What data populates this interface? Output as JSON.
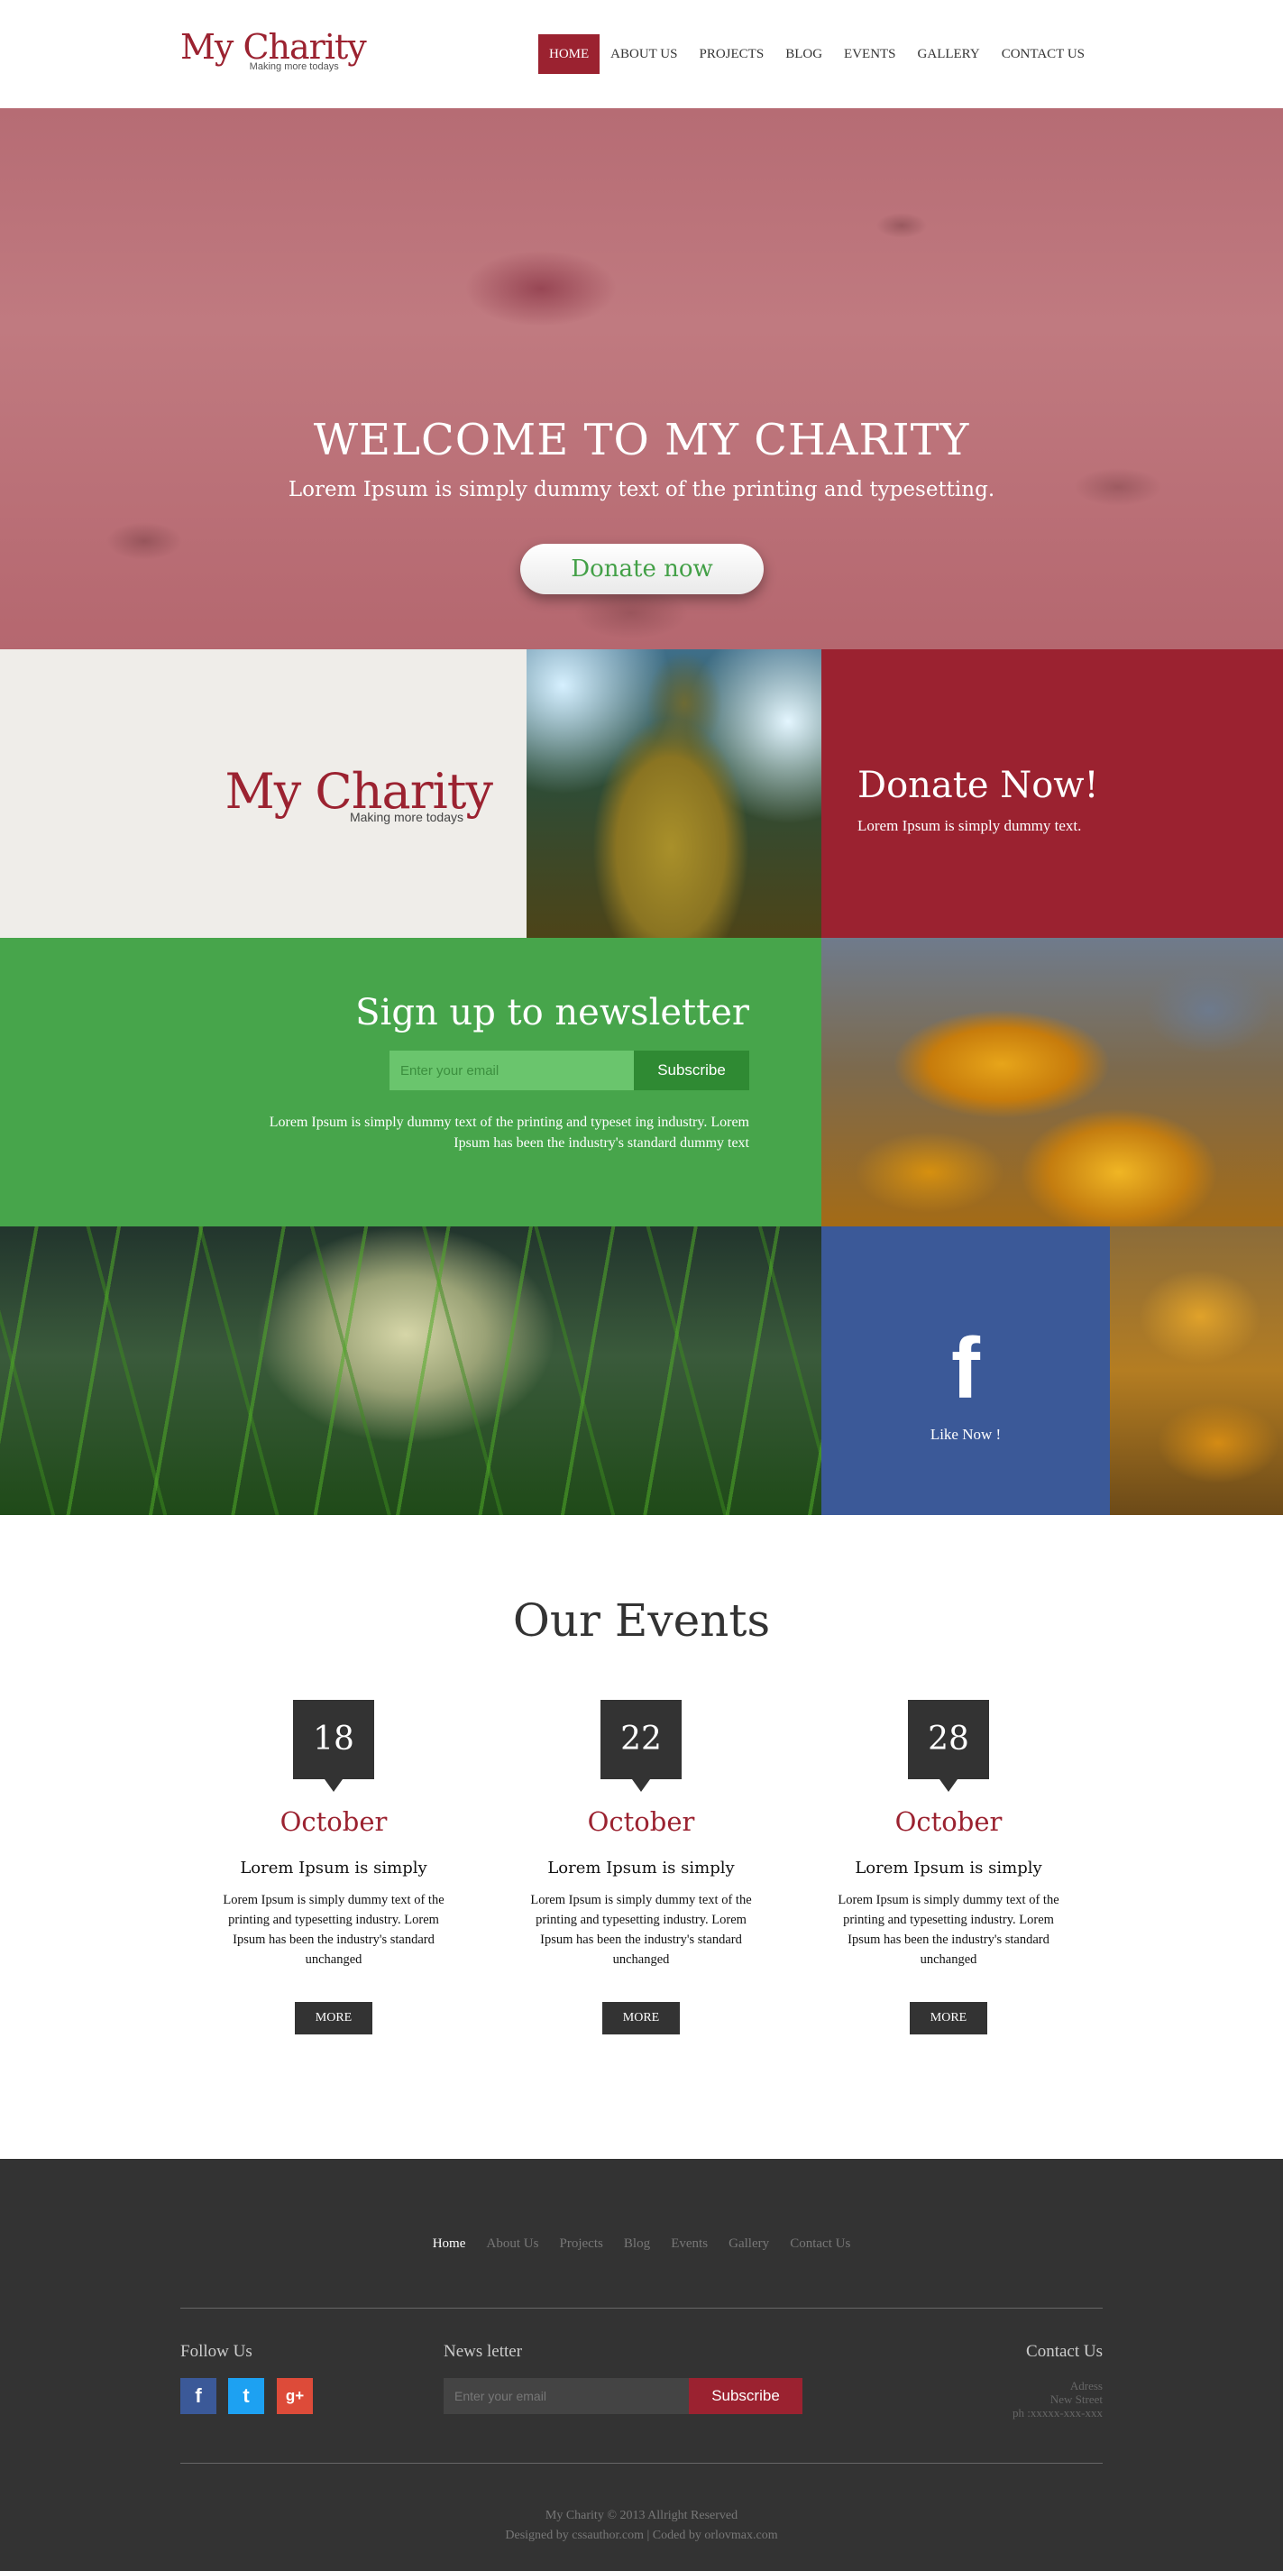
{
  "brand": {
    "name": "My Charity",
    "tagline": "Making more todays"
  },
  "nav": [
    {
      "label": "HOME",
      "active": true
    },
    {
      "label": "ABOUT US"
    },
    {
      "label": "PROJECTS"
    },
    {
      "label": "BLOG"
    },
    {
      "label": "EVENTS"
    },
    {
      "label": "GALLERY"
    },
    {
      "label": "CONTACT US"
    }
  ],
  "hero": {
    "title": "WELCOME TO MY CHARITY",
    "subtitle": "Lorem Ipsum is simply dummy text of the printing and typesetting.",
    "button": "Donate now"
  },
  "donate_tile": {
    "title": "Donate Now!",
    "text": "Lorem Ipsum is simply dummy text."
  },
  "newsletter": {
    "title": "Sign up to newsletter",
    "placeholder": "Enter your email",
    "button": "Subscribe",
    "text": "Lorem Ipsum is simply dummy text of the printing and typeset ing industry. Lorem Ipsum has been the industry's standard dummy text"
  },
  "facebook": {
    "icon": "facebook-icon",
    "label": "Like Now !"
  },
  "events": {
    "title": "Our Events",
    "items": [
      {
        "day": "18",
        "month": "October",
        "heading": "Lorem Ipsum is simply",
        "text": "Lorem Ipsum is simply dummy text of the printing and typesetting industry. Lorem Ipsum has been the industry's standard unchanged",
        "button": "MORE"
      },
      {
        "day": "22",
        "month": "October",
        "heading": "Lorem Ipsum is simply",
        "text": "Lorem Ipsum is simply dummy text of the printing and typesetting industry. Lorem Ipsum has been the industry's standard unchanged",
        "button": "MORE"
      },
      {
        "day": "28",
        "month": "October",
        "heading": "Lorem Ipsum is simply",
        "text": "Lorem Ipsum is simply dummy text of the printing and typesetting industry. Lorem Ipsum has been the industry's standard unchanged",
        "button": "MORE"
      }
    ]
  },
  "footer": {
    "nav": [
      "Home",
      "About Us",
      "Projects",
      "Blog",
      "Events",
      "Gallery",
      "Contact Us"
    ],
    "follow_title": "Follow Us",
    "social": [
      {
        "icon": "facebook-icon",
        "glyph": "f",
        "color": "#3b5998"
      },
      {
        "icon": "twitter-icon",
        "glyph": "t",
        "color": "#1da1f2"
      },
      {
        "icon": "google-plus-icon",
        "glyph": "g+",
        "color": "#dd4b39"
      }
    ],
    "newsletter_title": "News letter",
    "newsletter_placeholder": "Enter your email",
    "newsletter_button": "Subscribe",
    "contact_title": "Contact Us",
    "contact_lines": [
      "Adress",
      "New Street",
      "ph :xxxxx-xxx-xxx"
    ],
    "copyright": "My Charity © 2013 Allright Reserved",
    "credits": "Designed by cssauthor.com | Coded by orlovmax.com"
  },
  "colors": {
    "brand_red": "#9b2230",
    "green": "#47a54b",
    "facebook_blue": "#3b5998",
    "footer_bg": "#333333"
  }
}
